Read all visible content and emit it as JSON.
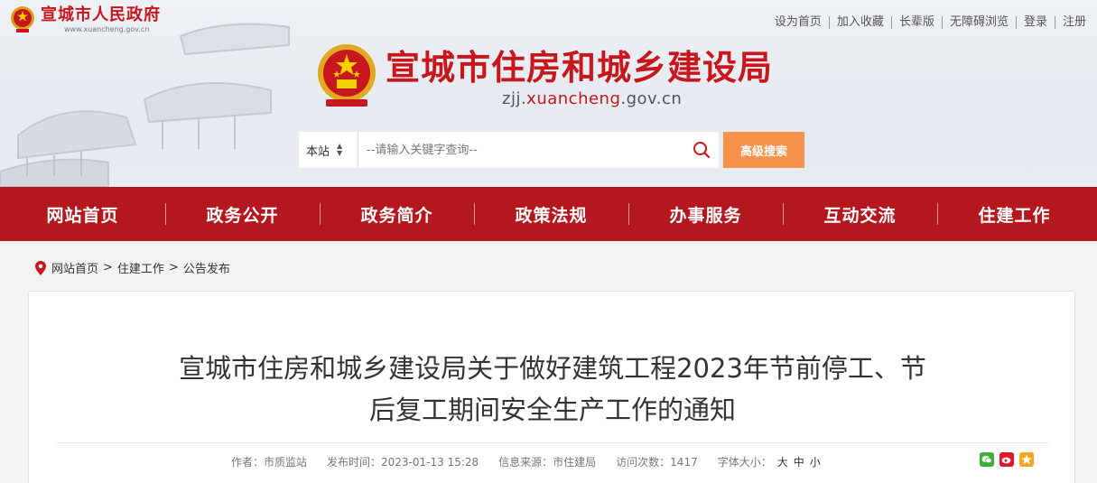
{
  "top_logo": {
    "name": "宣城市人民政府",
    "url": "www.xuancheng.gov.cn"
  },
  "toplinks": [
    "设为首页",
    "加入收藏",
    "长辈版",
    "无障碍浏览",
    "登录",
    "注册"
  ],
  "site": {
    "title": "宣城市住房和城乡建设局",
    "domain_pre": "zjj.",
    "domain_mid": "xuancheng",
    "domain_post": ".gov.cn"
  },
  "search": {
    "scope": "本站",
    "placeholder": "--请输入关键字查询--",
    "advanced_label": "高级搜索"
  },
  "nav": [
    "网站首页",
    "政务公开",
    "政务简介",
    "政策法规",
    "办事服务",
    "互动交流",
    "住建工作"
  ],
  "breadcrumb": {
    "home": "网站首页",
    "section": "住建工作",
    "current": "公告发布",
    "sep": ">"
  },
  "article": {
    "title_line1": "宣城市住房和城乡建设局关于做好建筑工程2023年节前停工、节",
    "title_line2": "后复工期间安全生产工作的通知",
    "author": "作者：市质监站",
    "published": "发布时间：2023-01-13 15:28",
    "source": "信息来源：市住建局",
    "views": "访问次数：1417",
    "font_size_label": "字体大小：",
    "font_large": "大",
    "font_medium": "中",
    "font_small": "小"
  },
  "colors": {
    "brand_red": "#c8161d",
    "nav_red": "#b4171d",
    "orange": "#f6924a",
    "wechat": "#3cb034",
    "weibo": "#e6162d",
    "qzone": "#f5a623"
  }
}
